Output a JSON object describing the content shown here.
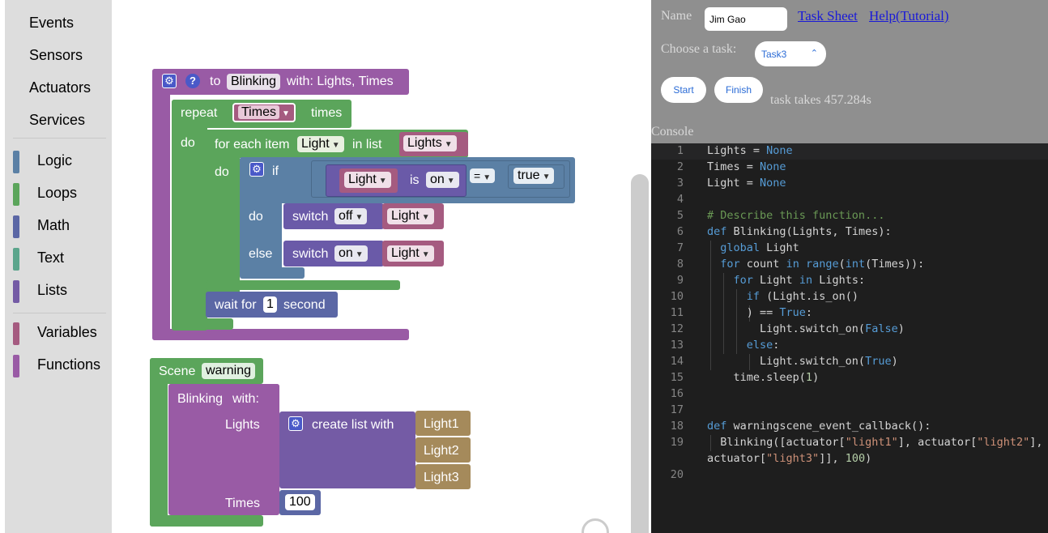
{
  "toolbox": {
    "plain": [
      "Events",
      "Sensors",
      "Actuators",
      "Services"
    ],
    "categories": [
      {
        "label": "Logic",
        "color": "#5b80a5"
      },
      {
        "label": "Loops",
        "color": "#5ba55b"
      },
      {
        "label": "Math",
        "color": "#5b67a5"
      },
      {
        "label": "Text",
        "color": "#5ba58c"
      },
      {
        "label": "Lists",
        "color": "#745ba5"
      },
      {
        "label": "Variables",
        "color": "#a55b80"
      },
      {
        "label": "Functions",
        "color": "#995ba5"
      }
    ]
  },
  "colors": {
    "function": "#995ba5",
    "loop": "#5ba55b",
    "logic": "#5b80a5",
    "math": "#5b67a5",
    "variable": "#a55b80",
    "list": "#745ba5",
    "text": "#a58a5b",
    "actuator": "#6a5aa8"
  },
  "blocks": {
    "func_to": "to",
    "func_name": "Blinking",
    "func_params": "with: Lights, Times",
    "repeat": "repeat",
    "times_var": "Times",
    "times": "times",
    "do": "do",
    "foreach": "for each item",
    "light_var": "Light",
    "in_list": "in list",
    "lights_var": "Lights",
    "if": "if",
    "is": "is",
    "on": "on",
    "eq": "=",
    "true": "true",
    "switch": "switch",
    "off": "off",
    "else": "else",
    "wait_for": "wait for",
    "wait_value": "1",
    "second": "second",
    "scene": "Scene",
    "scene_name": "warning",
    "call_name": "Blinking",
    "call_with": "with:",
    "arg_lights": "Lights",
    "create_list": "create list with",
    "light1": "Light1",
    "light2": "Light2",
    "light3": "Light3",
    "arg_times": "Times",
    "times_value": "100"
  },
  "panel": {
    "name_label": "Name",
    "name_value": "Jim Gao",
    "task_sheet": "Task Sheet",
    "help": "Help(Tutorial)",
    "choose_task": "Choose a task:",
    "task_selected": "Task3",
    "start": "Start",
    "finish": "Finish",
    "task_time": "task takes 457.284s",
    "console_label": "Console"
  },
  "console": {
    "line_numbers": [
      "1",
      "2",
      "3",
      "4",
      "5",
      "6",
      "7",
      "8",
      "9",
      "10",
      "11",
      "12",
      "13",
      "14",
      "15",
      "16",
      "17",
      "18",
      "19",
      "20"
    ]
  }
}
